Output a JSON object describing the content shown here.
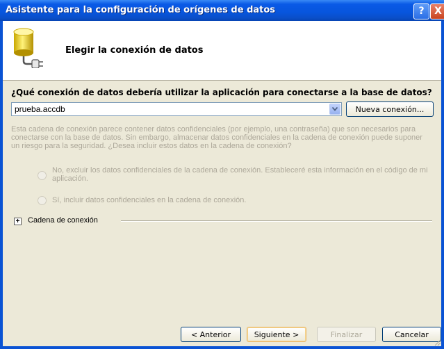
{
  "window": {
    "title": "Asistente para la configuración de orígenes de datos",
    "help_symbol": "?",
    "close_symbol": "X"
  },
  "header": {
    "title": "Elegir la conexión de datos",
    "icon": "database-connection-icon"
  },
  "connection": {
    "question": "¿Qué conexión de datos debería utilizar la aplicación para conectarse a la base de datos?",
    "selected_value": "prueba.accdb",
    "new_connection_label": "Nueva conexión..."
  },
  "sensitive": {
    "description": "Esta cadena de conexión parece contener datos confidenciales (por ejemplo, una contraseña) que son necesarios para conectarse con la base de datos. Sin embargo, almacenar datos confidenciales en la cadena de conexión puede suponer un riesgo para la seguridad. ¿Desea incluir estos datos en la cadena de conexión?",
    "option_exclude": "No, excluir los datos confidenciales de la cadena de conexión. Estableceré esta información en el código de mi aplicación.",
    "option_include": "Sí, incluir datos confidenciales en la cadena de conexión."
  },
  "connection_string": {
    "label": "Cadena de conexión",
    "expand_symbol": "+"
  },
  "buttons": {
    "previous": "< Anterior",
    "next": "Siguiente >",
    "finish": "Finalizar",
    "cancel": "Cancelar"
  }
}
